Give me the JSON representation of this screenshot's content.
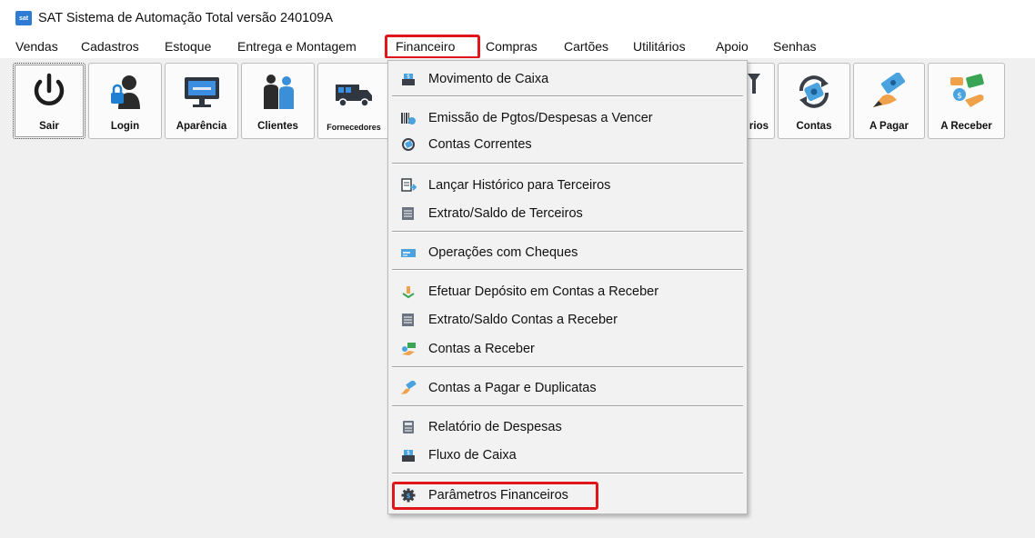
{
  "window": {
    "title": "SAT Sistema de Automação Total versão 240109A",
    "logo_text": "sat"
  },
  "menubar": {
    "items": [
      {
        "label": "Vendas"
      },
      {
        "label": "Cadastros"
      },
      {
        "label": "Estoque"
      },
      {
        "label": "Entrega e Montagem"
      },
      {
        "label": "Financeiro"
      },
      {
        "label": "Compras"
      },
      {
        "label": "Cartões"
      },
      {
        "label": "Utilitários"
      },
      {
        "label": "Apoio"
      },
      {
        "label": "Senhas"
      }
    ],
    "active": "Financeiro"
  },
  "toolbar": {
    "buttons": [
      {
        "label": "Sair",
        "icon": "power-icon"
      },
      {
        "label": "Login",
        "icon": "user-lock-icon"
      },
      {
        "label": "Aparência",
        "icon": "monitor-icon"
      },
      {
        "label": "Clientes",
        "icon": "clients-icon"
      },
      {
        "label": "Fornecedores",
        "icon": "truck-icon"
      },
      {
        "label": "rios",
        "icon": "reports-icon"
      },
      {
        "label": "Contas",
        "icon": "money-cycle-icon"
      },
      {
        "label": "A Pagar",
        "icon": "money-hand-icon"
      },
      {
        "label": "A Receber",
        "icon": "money-receive-icon"
      }
    ]
  },
  "financeiro_menu": {
    "items": [
      {
        "label": "Movimento de Caixa",
        "icon": "cash-register-icon"
      },
      {
        "label": "Emissão de Pgtos/Despesas a Vencer",
        "icon": "barcode-icon"
      },
      {
        "label": "Contas Correntes",
        "icon": "money-cycle-icon"
      },
      {
        "label": "Lançar Histórico para Terceiros",
        "icon": "document-arrow-icon"
      },
      {
        "label": "Extrato/Saldo de Terceiros",
        "icon": "statement-icon"
      },
      {
        "label": "Operações com Cheques",
        "icon": "check-icon"
      },
      {
        "label": "Efetuar Depósito em Contas a Receber",
        "icon": "deposit-icon"
      },
      {
        "label": "Extrato/Saldo Contas a Receber",
        "icon": "statement-icon"
      },
      {
        "label": "Contas a Receber",
        "icon": "money-receive-icon"
      },
      {
        "label": "Contas a Pagar e Duplicatas",
        "icon": "money-hand-icon"
      },
      {
        "label": "Relatório de Despesas",
        "icon": "report-icon"
      },
      {
        "label": "Fluxo de Caixa",
        "icon": "cash-register-icon"
      },
      {
        "label": "Parâmetros Financeiros",
        "icon": "gear-money-icon"
      }
    ],
    "highlighted": "Parâmetros Financeiros"
  },
  "colors": {
    "highlight_box": "#e0161b",
    "accent_blue": "#2d7bd3",
    "money_green": "#3aa655"
  }
}
